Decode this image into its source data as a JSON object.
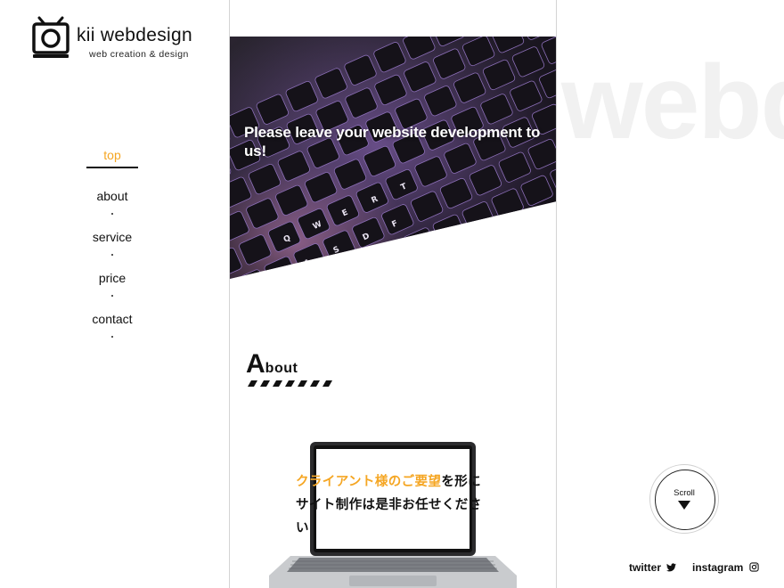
{
  "brand": {
    "name": "kii webdesign",
    "tagline": "web creation & design"
  },
  "nav": {
    "items": [
      {
        "label": "top",
        "active": true
      },
      {
        "label": "about",
        "active": false
      },
      {
        "label": "service",
        "active": false
      },
      {
        "label": "price",
        "active": false
      },
      {
        "label": "contact",
        "active": false
      }
    ]
  },
  "hero": {
    "title": "Please leave your website development to us!",
    "image": "keyboard-photo"
  },
  "about": {
    "heading_initial": "A",
    "heading_rest": "bout",
    "copy_highlight": "クライアント様のご要望",
    "copy_rest": "を形にサイト制作は是非お任せください"
  },
  "watermark": "webd",
  "scroll": {
    "label": "Scroll"
  },
  "social": {
    "twitter": "twitter",
    "instagram": "instagram"
  },
  "colors": {
    "accent": "#f5a623",
    "text": "#111111",
    "watermark": "#f1f1f1"
  }
}
